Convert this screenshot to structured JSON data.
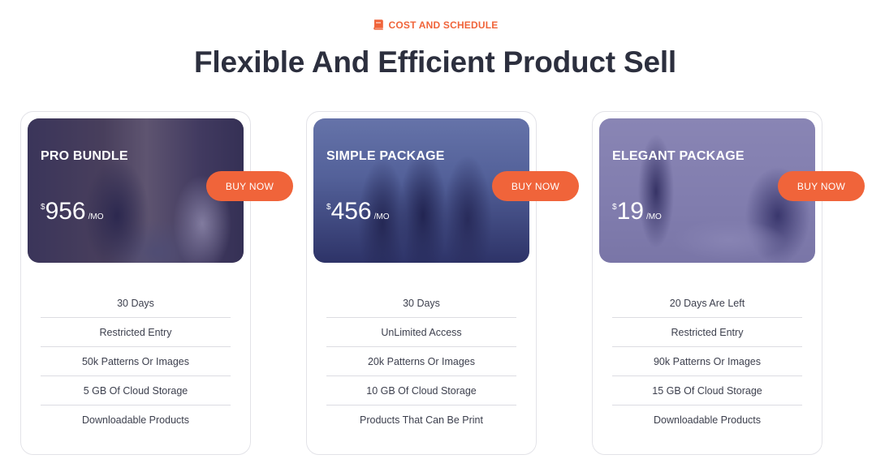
{
  "section": {
    "eyebrow": "COST AND SCHEDULE",
    "eyebrow_icon": "book-icon",
    "title": "Flexible And Efficient Product Sell"
  },
  "accent_color": "#f0643a",
  "plans": [
    {
      "name": "PRO BUNDLE",
      "currency": "$",
      "price": "956",
      "period": "/MO",
      "cta": "BUY NOW",
      "features": [
        "30 Days",
        "Restricted Entry",
        "50k Patterns Or Images",
        "5 GB Of Cloud Storage",
        "Downloadable Products"
      ]
    },
    {
      "name": "SIMPLE PACKAGE",
      "currency": "$",
      "price": "456",
      "period": "/MO",
      "cta": "BUY NOW",
      "features": [
        "30 Days",
        "UnLimited Access",
        "20k Patterns Or Images",
        "10 GB Of Cloud Storage",
        "Products That Can Be Print"
      ]
    },
    {
      "name": "ELEGANT PACKAGE",
      "currency": "$",
      "price": "19",
      "period": "/MO",
      "cta": "BUY NOW",
      "features": [
        "20 Days Are Left",
        "Restricted Entry",
        "90k Patterns Or Images",
        "15 GB Of Cloud Storage",
        "Downloadable Products"
      ]
    }
  ]
}
